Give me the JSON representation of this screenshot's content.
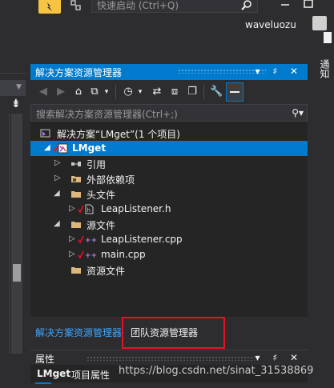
{
  "titlebar": {
    "quicklaunch_placeholder": "快速启动 (Ctrl+Q)",
    "username": "waveluozu"
  },
  "right_strip": {
    "label": "通知"
  },
  "solution_explorer": {
    "title": "解决方案资源管理器",
    "title_buttons": "▾ ♯ ✕",
    "search_placeholder": "搜索解决方案资源管理器(Ctrl+;)",
    "tree": [
      {
        "label": "解决方案“LMget”(1 个项目)",
        "icon": "solution-icon",
        "expander": ""
      },
      {
        "label": "LMget",
        "icon": "project-icon",
        "expander": "◢",
        "selected": true
      },
      {
        "label": "引用",
        "icon": "references-icon",
        "expander": "▷"
      },
      {
        "label": "外部依赖项",
        "icon": "external-deps-icon",
        "expander": "▷"
      },
      {
        "label": "头文件",
        "icon": "folder-icon",
        "expander": "◢"
      },
      {
        "label": "LeapListener.h",
        "icon": "header-file-icon",
        "expander": "▷"
      },
      {
        "label": "源文件",
        "icon": "folder-icon",
        "expander": "◢"
      },
      {
        "label": "LeapListener.cpp",
        "icon": "cpp-file-icon",
        "expander": "▷"
      },
      {
        "label": "main.cpp",
        "icon": "cpp-file-icon",
        "expander": "▷"
      },
      {
        "label": "资源文件",
        "icon": "folder-icon",
        "expander": ""
      }
    ],
    "tabs": {
      "solution_explorer": "解决方案资源管理器",
      "team_explorer": "团队资源管理器"
    }
  },
  "properties": {
    "title": "属性",
    "title_buttons": "▾ ♯ ✕",
    "object_name": "LMget",
    "object_kind": "项目属性"
  },
  "watermark": "https://blog.csdn.net/sinat_31538869",
  "colors": {
    "accent": "#007acc",
    "highlight_box": "#e81123",
    "background": "#2d2d30"
  }
}
